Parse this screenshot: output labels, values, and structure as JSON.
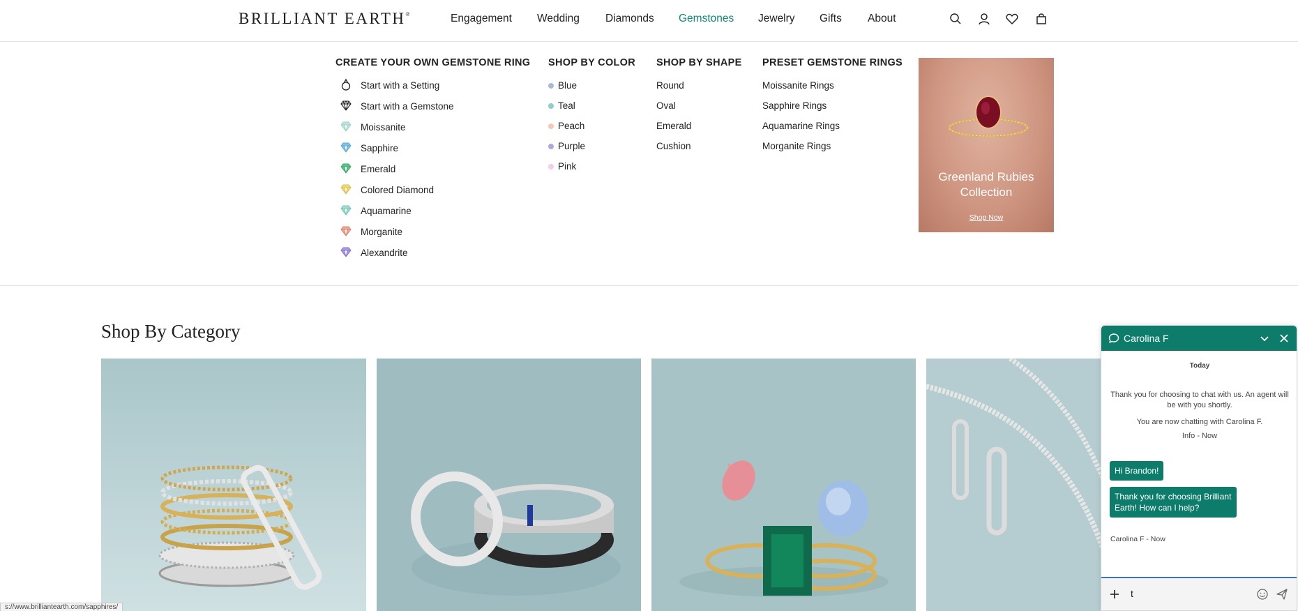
{
  "header": {
    "logo": "BRILLIANT EARTH",
    "logo_mark": "®",
    "nav": [
      "Engagement",
      "Wedding",
      "Diamonds",
      "Gemstones",
      "Jewelry",
      "Gifts",
      "About"
    ],
    "active_nav": "Gemstones",
    "icons": [
      "search-icon",
      "account-icon",
      "wishlist-heart-icon",
      "shopping-bag-icon"
    ]
  },
  "mega_menu": {
    "create": {
      "heading": "CREATE YOUR OWN GEMSTONE RING",
      "items": [
        {
          "label": "Start with a Setting",
          "icon": "ring-setting-icon",
          "color": "#222222"
        },
        {
          "label": "Start with a Gemstone",
          "icon": "gemstone-outline-icon",
          "color": "#222222"
        },
        {
          "label": "Moissanite",
          "icon": "moissanite-icon",
          "color": "#bfe4df"
        },
        {
          "label": "Sapphire",
          "icon": "sapphire-icon",
          "color": "#86c2e6"
        },
        {
          "label": "Emerald",
          "icon": "emerald-icon",
          "color": "#5fc48a"
        },
        {
          "label": "Colored Diamond",
          "icon": "colored-diamond-icon",
          "color": "#efd97a"
        },
        {
          "label": "Aquamarine",
          "icon": "aquamarine-icon",
          "color": "#9fdcd0"
        },
        {
          "label": "Morganite",
          "icon": "morganite-icon",
          "color": "#f0a594"
        },
        {
          "label": "Alexandrite",
          "icon": "alexandrite-icon",
          "color": "#a99ae0"
        }
      ]
    },
    "color": {
      "heading": "SHOP BY COLOR",
      "items": [
        {
          "label": "Blue",
          "color": "#a9bcd6"
        },
        {
          "label": "Teal",
          "color": "#8ccfcf"
        },
        {
          "label": "Peach",
          "color": "#f6c8b4"
        },
        {
          "label": "Purple",
          "color": "#b4a6dd"
        },
        {
          "label": "Pink",
          "color": "#f4cde6"
        }
      ]
    },
    "shape": {
      "heading": "SHOP BY SHAPE",
      "items": [
        "Round",
        "Oval",
        "Emerald",
        "Cushion"
      ]
    },
    "preset": {
      "heading": "PRESET GEMSTONE RINGS",
      "items": [
        "Moissanite Rings",
        "Sapphire Rings",
        "Aquamarine Rings",
        "Morganite Rings"
      ]
    },
    "promo": {
      "title": "Greenland Rubies Collection",
      "link": "Shop Now"
    }
  },
  "category_section": {
    "title": "Shop By Category",
    "cards": [
      "stacked-diamond-bands-image",
      "mens-wedding-bands-image",
      "gemstone-rings-image",
      "diamond-jewelry-image"
    ]
  },
  "status_bar": {
    "url": "s://www.brilliantearth.com/sapphires/"
  },
  "chat": {
    "agent": "Carolina F",
    "day": "Today",
    "system_messages": [
      "Thank you for choosing to chat with us. An agent will be with you shortly.",
      "You are now chatting with Carolina F."
    ],
    "system_meta": "Info - Now",
    "messages": [
      "Hi Brandon!",
      "Thank you for choosing Brilliant Earth! How can I help?"
    ],
    "message_meta": "Carolina F - Now",
    "input_value": "t",
    "accent": "#0e7c6a"
  }
}
